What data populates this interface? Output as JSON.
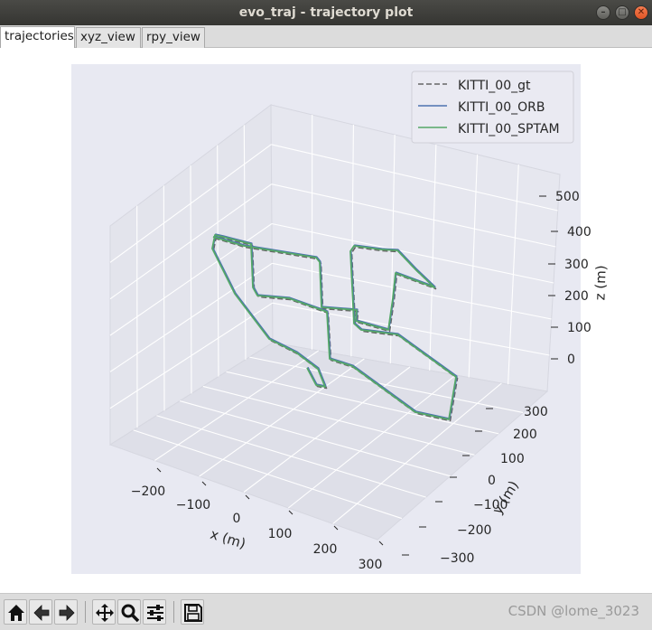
{
  "window": {
    "title": "evo_traj - trajectory plot"
  },
  "tabs": [
    {
      "label": "trajectories",
      "active": true
    },
    {
      "label": "xyz_view",
      "active": false
    },
    {
      "label": "rpy_view",
      "active": false
    }
  ],
  "toolbar": {
    "buttons": [
      "home-icon",
      "back-icon",
      "forward-icon",
      "pan-icon",
      "zoom-icon",
      "configure-icon",
      "save-icon"
    ]
  },
  "watermark": "CSDN @lome_3023",
  "chart_data": {
    "type": "line",
    "projection": "3d",
    "xlabel": "x (m)",
    "ylabel": "y (m)",
    "zlabel": "z (m)",
    "x_ticks": [
      "−200",
      "−100",
      "0",
      "100",
      "200",
      "300"
    ],
    "y_ticks": [
      "−300",
      "−200",
      "−100",
      "0",
      "100",
      "200",
      "300"
    ],
    "z_ticks": [
      "0",
      "100",
      "200",
      "300",
      "400",
      "500"
    ],
    "legend_position": "top-right",
    "background": "#e8e9f2",
    "series": [
      {
        "name": "KITTI_00_gt",
        "color": "#666666",
        "style": "dashed"
      },
      {
        "name": "KITTI_00_ORB",
        "color": "#4c72b0",
        "style": "solid"
      },
      {
        "name": "KITTI_00_SPTAM",
        "color": "#55a868",
        "style": "solid"
      }
    ]
  }
}
